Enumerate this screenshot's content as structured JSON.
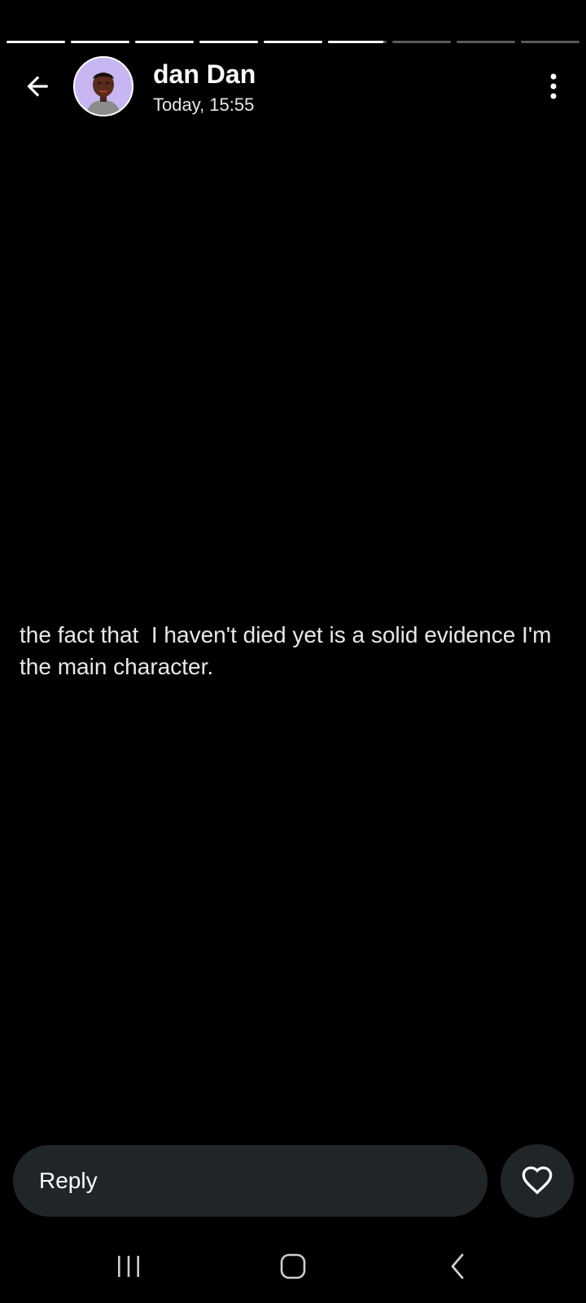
{
  "story": {
    "segment_count": 9,
    "segments_viewed": 5,
    "current_segment_progress": 0.95
  },
  "header": {
    "name": "dan Dan",
    "time": "Today, 15:55",
    "back_icon": "arrow-left-icon",
    "more_icon": "more-vertical-icon"
  },
  "status": {
    "text": "the fact that  I haven't died yet is a solid evidence I'm the main character."
  },
  "reply": {
    "placeholder": "Reply",
    "like_icon": "heart-outline-icon"
  },
  "navbar": {
    "recents_icon": "recents-icon",
    "home_icon": "home-icon",
    "back_icon": "nav-back-icon"
  },
  "colors": {
    "background": "#000000",
    "input_bg": "#202529",
    "progress_active": "#ffffff",
    "progress_inactive": "#5a5a5a",
    "avatar_bg": "#c7b6f2"
  }
}
